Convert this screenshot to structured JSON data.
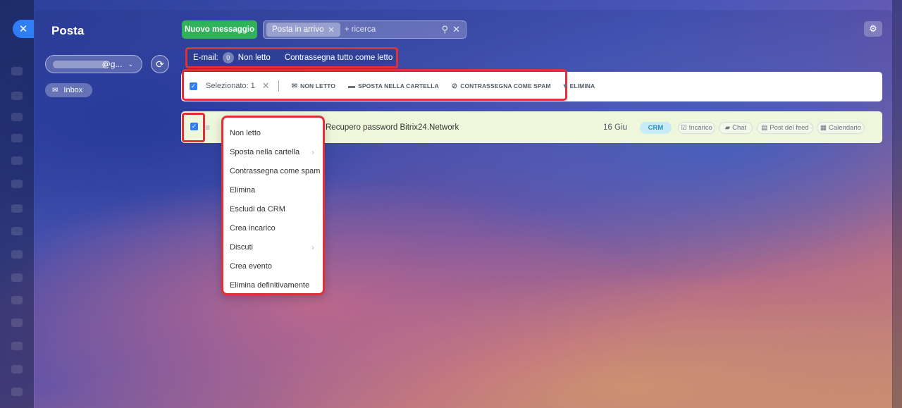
{
  "app": {
    "title": "Posta"
  },
  "sidebar": {
    "account_suffix": "@g...",
    "inbox_label": "Inbox"
  },
  "header": {
    "new_message_label": "Nuovo messaggio",
    "filter_tag": "Posta in arrivo",
    "search_placeholder": "+ ricerca"
  },
  "email_bar": {
    "label": "E-mail:",
    "unread_count": "0",
    "unread_label": "Non letto",
    "mark_all_label": "Contrassegna tutto come letto"
  },
  "toolbar": {
    "selected_label": "Selezionato: 1",
    "actions": [
      {
        "label": "NON LETTO",
        "icon": "envelope-icon"
      },
      {
        "label": "SPOSTA NELLA CARTELLA",
        "icon": "folder-icon"
      },
      {
        "label": "CONTRASSEGNA COME SPAM",
        "icon": "spam-icon"
      },
      {
        "label": "ELIMINA",
        "icon": "trash-icon"
      }
    ]
  },
  "message": {
    "subject": "Recupero password Bitrix24.Network",
    "date": "16 Giu",
    "tags": [
      "CRM",
      "Incarico",
      "Chat",
      "Post del feed",
      "Calendario"
    ]
  },
  "context_menu": {
    "items": [
      {
        "label": "Non letto",
        "submenu": false
      },
      {
        "label": "Sposta nella cartella",
        "submenu": true
      },
      {
        "label": "Contrassegna come spam",
        "submenu": false
      },
      {
        "label": "Elimina",
        "submenu": false
      },
      {
        "label": "Escludi da CRM",
        "submenu": false
      },
      {
        "label": "Crea incarico",
        "submenu": false
      },
      {
        "label": "Discuti",
        "submenu": true
      },
      {
        "label": "Crea evento",
        "submenu": false
      },
      {
        "label": "Elimina definitivamente",
        "submenu": false
      }
    ]
  },
  "colors": {
    "accent_blue": "#2f7ef5",
    "green_button": "#2fb25a",
    "highlight_red": "#e0303a",
    "row_bg": "#eef7dc"
  }
}
